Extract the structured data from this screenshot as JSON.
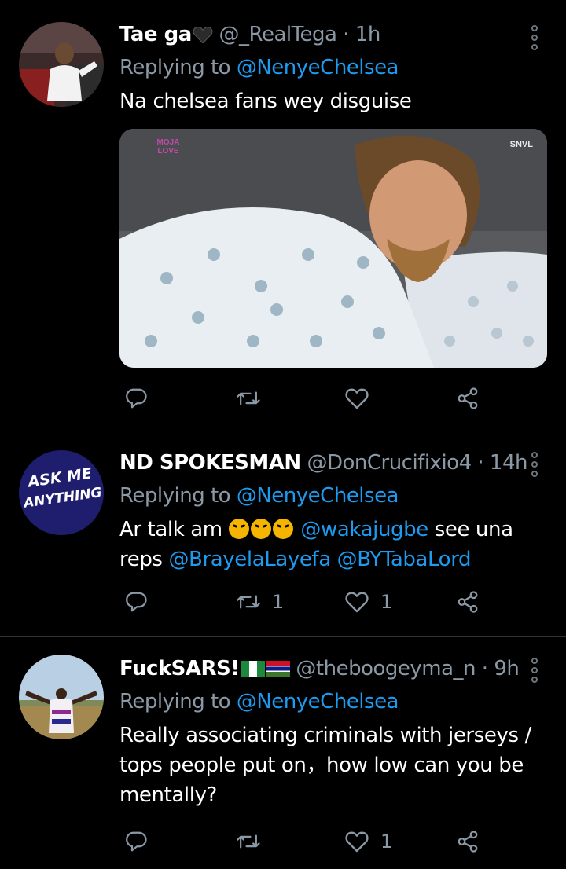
{
  "tweets": [
    {
      "name": "Tae ga",
      "handle": "@_RealTega",
      "dot": "·",
      "time": "1h",
      "replying_prefix": "Replying to ",
      "replying_to": "@NenyeChelsea",
      "text": "Na chelsea fans wey disguise",
      "media_label_left": "MOJA LOVE",
      "media_label_right": "SNVL",
      "retweets": "",
      "likes": ""
    },
    {
      "name": "ND SPOKESMAN",
      "handle": "@DonCrucifixio4",
      "dot": "·",
      "time": "14h",
      "replying_prefix": "Replying to ",
      "replying_to": "@NenyeChelsea",
      "text_part1": "Ar talk am ",
      "mention1": "@wakajugbe",
      "text_part2": " see una reps ",
      "mention2": "@BrayelaLayefa",
      "mention3": "@BYTabaLord",
      "avatar_text_line1": "ASK ME",
      "avatar_text_line2": "ANYTHING",
      "retweets": "1",
      "likes": "1"
    },
    {
      "name": "FuckSARS!",
      "handle": "@theboogeyma_n",
      "dot": "·",
      "time": "9h",
      "replying_prefix": "Replying to ",
      "replying_to": "@NenyeChelsea",
      "text": "Really associating criminals with jerseys / tops people put on，how low can you be mentally?",
      "retweets": "",
      "likes": "1"
    }
  ],
  "colors": {
    "background": "#000000",
    "text": "#ffffff",
    "secondary": "#8b98a5",
    "accent": "#1d9bf0",
    "divider": "#2f3336"
  },
  "icons": {
    "reply": "reply-icon",
    "retweet": "retweet-icon",
    "like": "heart-icon",
    "share": "share-icon",
    "more": "more-options-icon"
  }
}
